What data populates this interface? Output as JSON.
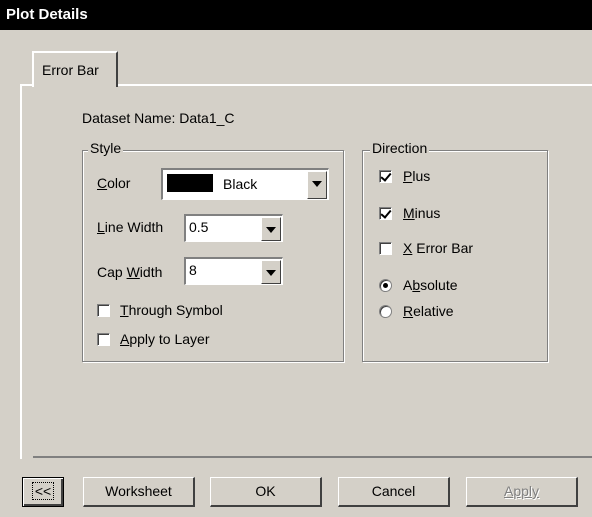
{
  "window": {
    "title": "Plot Details"
  },
  "tabs": [
    {
      "label": "Error Bar"
    }
  ],
  "dataset": {
    "label": "Dataset Name: Data1_C"
  },
  "style": {
    "legend": "Style",
    "color_label": "Color",
    "color_value": "Black",
    "color_swatch": "#000000",
    "line_width_label": "Line Width",
    "line_width_value": "0.5",
    "cap_width_label": "Cap Width",
    "cap_width_value": "8",
    "through_symbol_label": "Through Symbol",
    "through_symbol_checked": false,
    "apply_to_layer_label": "Apply to Layer",
    "apply_to_layer_checked": false
  },
  "direction": {
    "legend": "Direction",
    "plus_label": "Plus",
    "plus_checked": true,
    "minus_label": "Minus",
    "minus_checked": true,
    "x_error_bar_label": "X Error Bar",
    "x_error_bar_checked": false,
    "absolute_label": "Absolute",
    "relative_label": "Relative",
    "selected_mode": "Absolute"
  },
  "buttons": {
    "collapse_label": "<<",
    "worksheet_label": "Worksheet",
    "ok_label": "OK",
    "cancel_label": "Cancel",
    "apply_label": "Apply",
    "apply_disabled": true
  }
}
